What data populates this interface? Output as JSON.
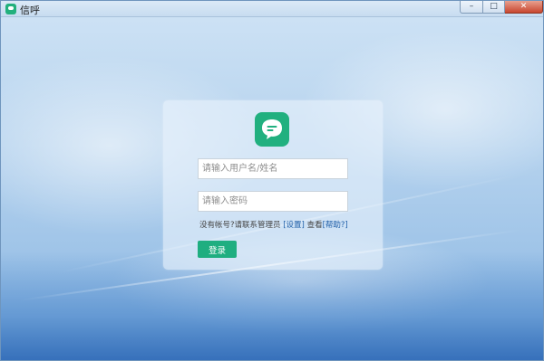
{
  "window": {
    "title": "信呼",
    "controls": {
      "minimize": "–",
      "maximize": "□",
      "close": "✕"
    }
  },
  "login": {
    "username_placeholder": "请输入用户名/姓名",
    "password_placeholder": "请输入密码",
    "username_value": "",
    "password_value": "",
    "hint_text": "没有帐号?请联系管理员",
    "settings_link": "[设置]",
    "view_text": "查看",
    "help_link": "[帮助?]",
    "submit_label": "登录"
  },
  "icons": {
    "app": "chat-bubble-icon",
    "logo": "chat-bubble-icon"
  },
  "colors": {
    "accent": "#1fae80",
    "link": "#1f5fa8",
    "background_sky": "#9fc4e8"
  }
}
